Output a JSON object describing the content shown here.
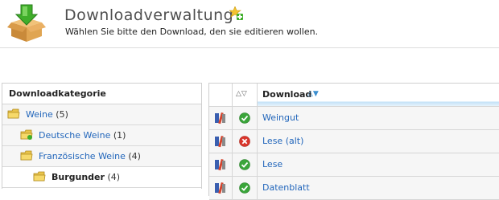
{
  "header": {
    "title": "Downloadverwaltung",
    "subtitle": "Wählen Sie bitte den Download, den sie editieren wollen."
  },
  "categories": {
    "heading": "Downloadkategorie",
    "items": [
      {
        "label": "Weine",
        "count": "(5)",
        "level": 0,
        "selected": false
      },
      {
        "label": "Deutsche Weine",
        "count": "(1)",
        "level": 1,
        "selected": false
      },
      {
        "label": "Französische Weine",
        "count": "(4)",
        "level": 1,
        "selected": false
      },
      {
        "label": "Burgunder",
        "count": "(4)",
        "level": 2,
        "selected": true
      }
    ]
  },
  "downloads": {
    "status_sort": "△▽",
    "heading": "Download",
    "name_sort": "△▼",
    "rows": [
      {
        "name": "Weingut",
        "status": "active"
      },
      {
        "name": "Lese (alt)",
        "status": "inactive"
      },
      {
        "name": "Lese",
        "status": "active"
      },
      {
        "name": "Datenblatt",
        "status": "active"
      }
    ]
  },
  "colors": {
    "link": "#2266bb",
    "active_green": "#3aa53a",
    "inactive_red": "#d9352b"
  },
  "icons": {
    "logo": "download-box-icon",
    "add": "add-plus-star-icon",
    "folder": "folder-icon",
    "edit": "edit-tools-icon",
    "active": "check-circle-icon",
    "inactive": "x-circle-icon"
  }
}
